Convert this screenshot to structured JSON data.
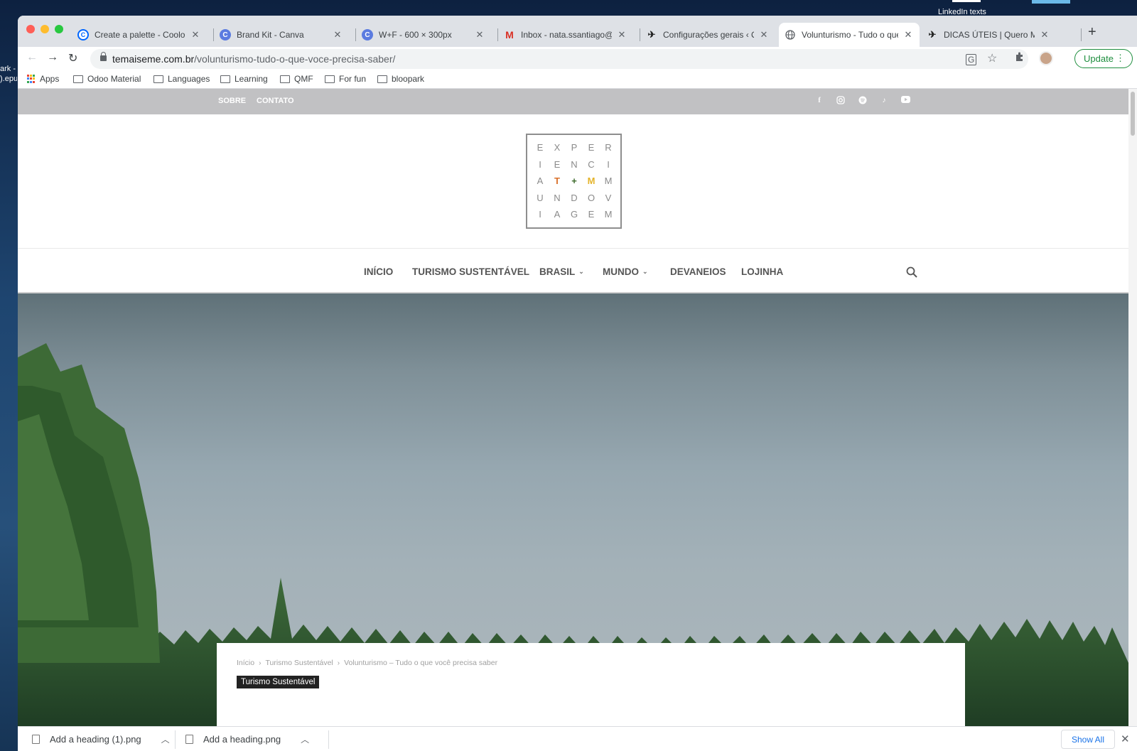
{
  "desktop": {
    "left_label": "ark -\n).epu",
    "top_text": "LinkedIn texts"
  },
  "tabs": [
    {
      "title": "Create a palette - Coolors",
      "icon": "coolors-icon",
      "active": false
    },
    {
      "title": "Brand Kit - Canva",
      "icon": "canva-icon",
      "active": false
    },
    {
      "title": "W+F - 600 × 300px",
      "icon": "canva-icon",
      "active": false
    },
    {
      "title": "Inbox - nata.ssantiago@gm",
      "icon": "gmail-icon",
      "active": false
    },
    {
      "title": "Configurações gerais ‹ Qu",
      "icon": "airplane-icon",
      "active": false
    },
    {
      "title": "Volunturismo - Tudo o que",
      "icon": "globe-icon",
      "active": true
    },
    {
      "title": "DICAS ÚTEIS | Quero Mais",
      "icon": "airplane-icon",
      "active": false
    }
  ],
  "toolbar": {
    "url_domain": "temaiseme.com.br",
    "url_path": "/volunturismo-tudo-o-que-voce-precisa-saber/",
    "update_label": "Update"
  },
  "bookmarks": {
    "apps_label": "Apps",
    "folders": [
      "Odoo Material",
      "Languages",
      "Learning",
      "QMF",
      "For fun",
      "bloopark"
    ]
  },
  "site": {
    "top_links": [
      "SOBRE",
      "CONTATO"
    ],
    "social_icons": [
      "facebook-icon",
      "instagram-icon",
      "spotify-icon",
      "tiktok-icon",
      "youtube-icon"
    ],
    "logo_letters": [
      [
        "E",
        "X",
        "P",
        "E",
        "R"
      ],
      [
        "I",
        "E",
        "N",
        "C",
        "I"
      ],
      [
        "A",
        "T",
        "+",
        "M",
        "M"
      ],
      [
        "U",
        "N",
        "D",
        "O",
        "V"
      ],
      [
        "I",
        "A",
        "G",
        "E",
        "M"
      ]
    ],
    "nav": [
      {
        "label": "INÍCIO",
        "dropdown": false
      },
      {
        "label": "TURISMO SUSTENTÁVEL",
        "dropdown": false
      },
      {
        "label": "BRASIL",
        "dropdown": true
      },
      {
        "label": "MUNDO",
        "dropdown": true
      },
      {
        "label": "DEVANEIOS",
        "dropdown": false
      },
      {
        "label": "LOJINHA",
        "dropdown": false
      }
    ],
    "breadcrumbs": [
      "Início",
      "Turismo Sustentável",
      "Volunturismo – Tudo o que você precisa saber"
    ],
    "category_badge": "Turismo Sustentável"
  },
  "downloads": {
    "items": [
      "Add a heading (1).png",
      "Add a heading.png"
    ],
    "show_all_label": "Show All"
  },
  "colors": {
    "logo_orange": "#d9712b",
    "logo_green": "#3d6b2c",
    "logo_yellow": "#e4b42b",
    "topbar_gray": "#c1c1c3",
    "update_green": "#1e8e3e"
  }
}
